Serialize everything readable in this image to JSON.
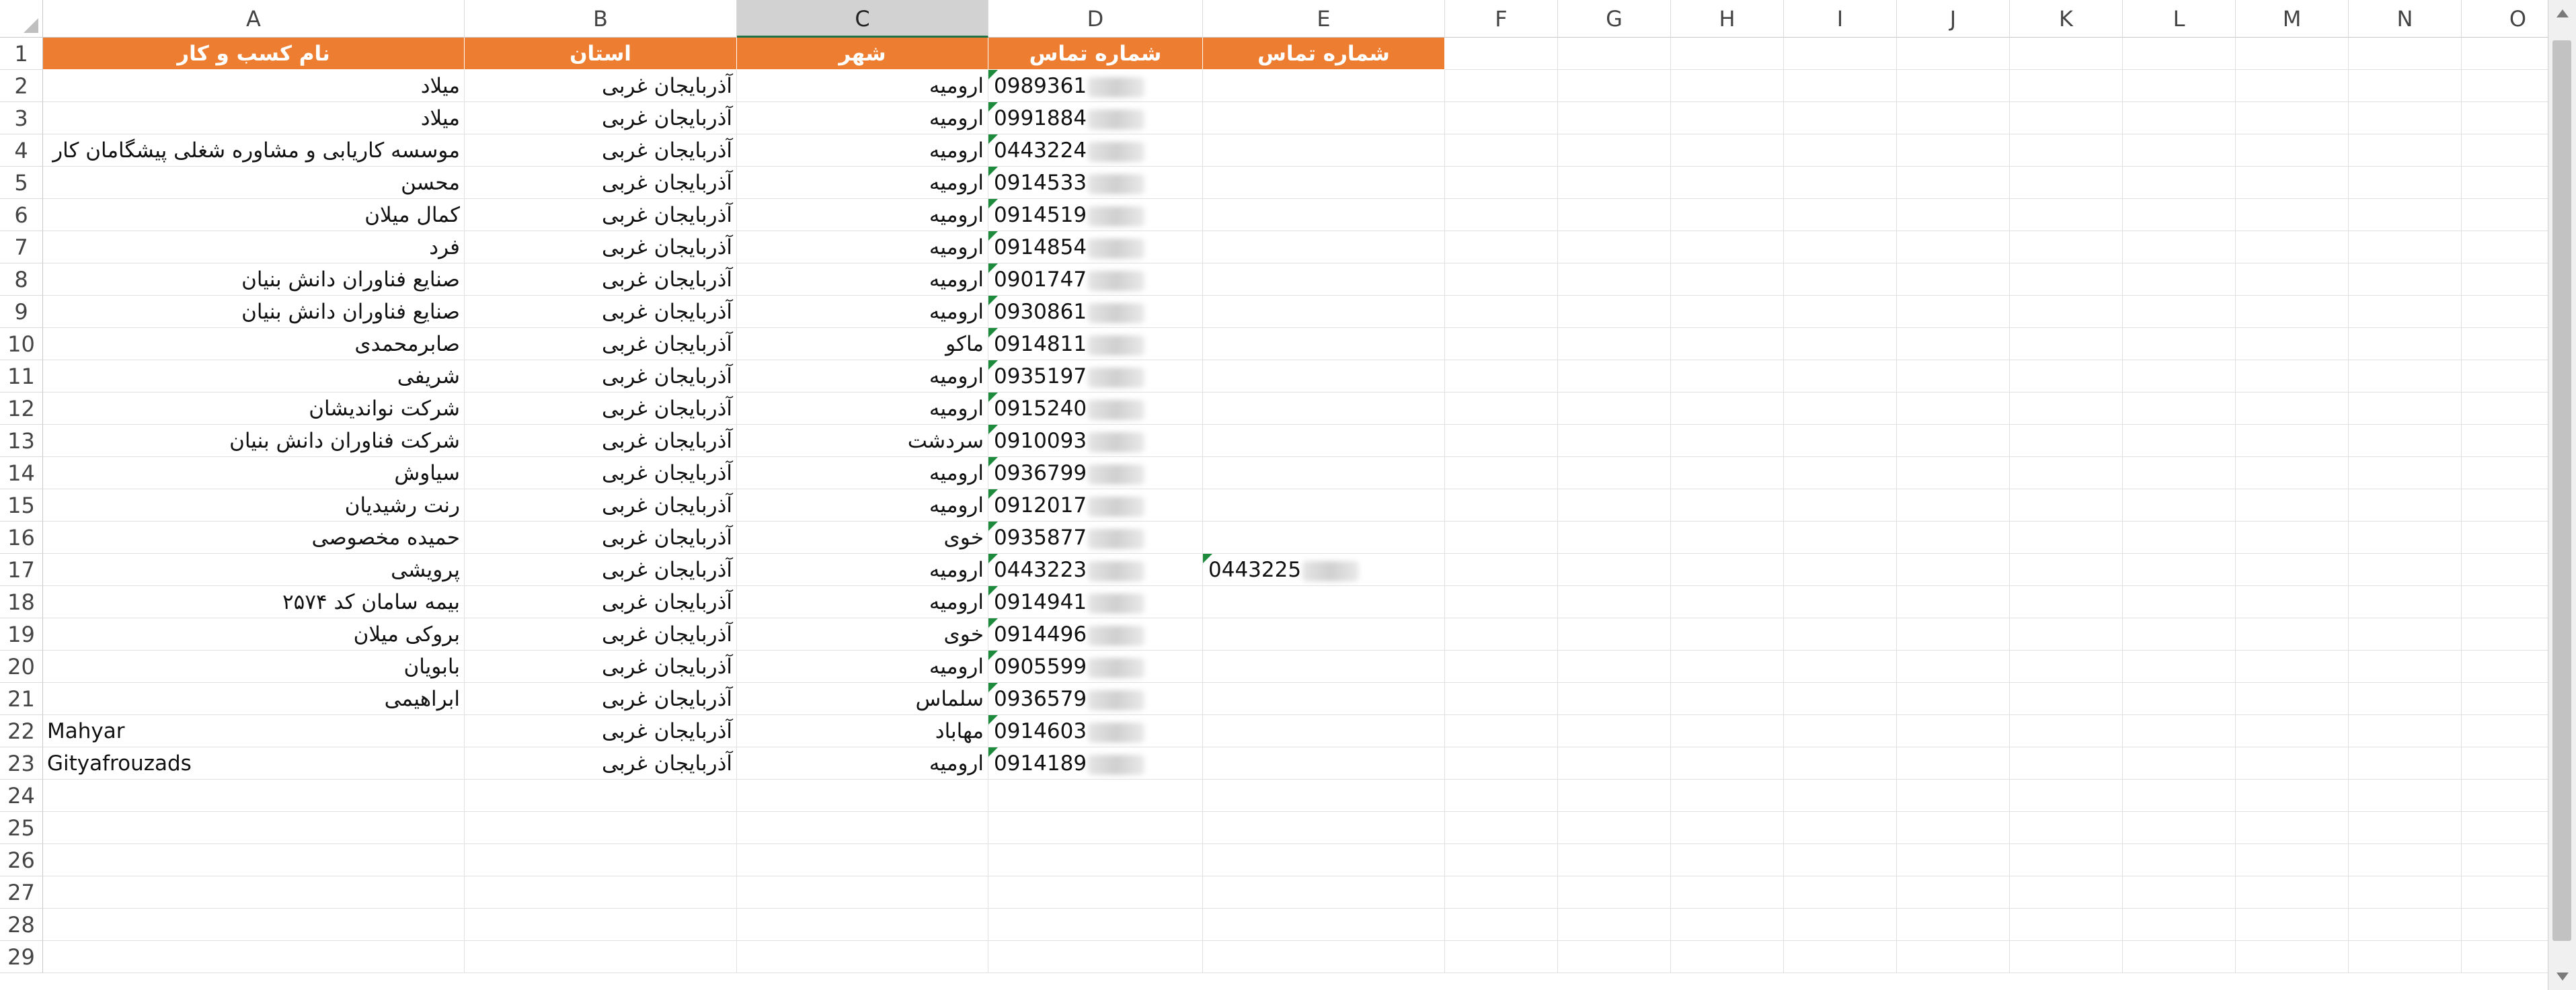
{
  "columns": [
    "A",
    "B",
    "C",
    "D",
    "E",
    "F",
    "G",
    "H",
    "I",
    "J",
    "K",
    "L",
    "M",
    "N",
    "O"
  ],
  "selected_column": "C",
  "header_row": {
    "A": "نام کسب و کار",
    "B": "استان",
    "C": "شهر",
    "D": "شماره تماس",
    "E": "شماره تماس"
  },
  "rows": [
    {
      "num": "2",
      "a": "میلاد",
      "b": "آذربایجان غربی",
      "c": "ارومیه",
      "d": "0989361"
    },
    {
      "num": "3",
      "a": "میلاد",
      "b": "آذربایجان غربی",
      "c": "ارومیه",
      "d": "0991884"
    },
    {
      "num": "4",
      "a": "موسسه کاریابی و مشاوره شغلی پیشگامان کار",
      "b": "آذربایجان غربی",
      "c": "ارومیه",
      "d": "0443224"
    },
    {
      "num": "5",
      "a": "محسن",
      "b": "آذربایجان غربی",
      "c": "ارومیه",
      "d": "0914533"
    },
    {
      "num": "6",
      "a": "کمال میلان",
      "b": "آذربایجان غربی",
      "c": "ارومیه",
      "d": "0914519"
    },
    {
      "num": "7",
      "a": "فرد",
      "b": "آذربایجان غربی",
      "c": "ارومیه",
      "d": "0914854"
    },
    {
      "num": "8",
      "a": "صنایع فناوران دانش بنیان",
      "b": "آذربایجان غربی",
      "c": "ارومیه",
      "d": "0901747"
    },
    {
      "num": "9",
      "a": "صنایع فناوران دانش بنیان",
      "b": "آذربایجان غربی",
      "c": "ارومیه",
      "d": "0930861"
    },
    {
      "num": "10",
      "a": "صابرمحمدی",
      "b": "آذربایجان غربی",
      "c": "ماکو",
      "d": "0914811"
    },
    {
      "num": "11",
      "a": "شریفی",
      "b": "آذربایجان غربی",
      "c": "ارومیه",
      "d": "0935197"
    },
    {
      "num": "12",
      "a": "شرکت نواندیشان",
      "b": "آذربایجان غربی",
      "c": "ارومیه",
      "d": "0915240"
    },
    {
      "num": "13",
      "a": "شرکت فناوران دانش بنیان",
      "b": "آذربایجان غربی",
      "c": "سردشت",
      "d": "0910093"
    },
    {
      "num": "14",
      "a": "سیاوش",
      "b": "آذربایجان غربی",
      "c": "ارومیه",
      "d": "0936799"
    },
    {
      "num": "15",
      "a": "رنت رشیدیان",
      "b": "آذربایجان غربی",
      "c": "ارومیه",
      "d": "0912017"
    },
    {
      "num": "16",
      "a": "حمیده مخصوصی",
      "b": "آذربایجان غربی",
      "c": "خوی",
      "d": "0935877"
    },
    {
      "num": "17",
      "a": "پرویشی",
      "b": "آذربایجان غربی",
      "c": "ارومیه",
      "d": "0443223",
      "e": "0443225"
    },
    {
      "num": "18",
      "a": "بیمه سامان کد ۲۵۷۴",
      "b": "آذربایجان غربی",
      "c": "ارومیه",
      "d": "0914941"
    },
    {
      "num": "19",
      "a": "بروکی میلان",
      "b": "آذربایجان غربی",
      "c": "خوی",
      "d": "0914496"
    },
    {
      "num": "20",
      "a": "بابویان",
      "b": "آذربایجان غربی",
      "c": "ارومیه",
      "d": "0905599"
    },
    {
      "num": "21",
      "a": "ابراهیمی",
      "b": "آذربایجان غربی",
      "c": "سلماس",
      "d": "0936579"
    },
    {
      "num": "22",
      "a": "Mahyar",
      "b": "آذربایجان غربی",
      "c": "مهاباد",
      "d": "0914603"
    },
    {
      "num": "23",
      "a": "Gityafrouzads",
      "b": "آذربایجان غربی",
      "c": "ارومیه",
      "d": "0914189"
    }
  ],
  "empty_rows": [
    "24",
    "25",
    "26",
    "27",
    "28",
    "29"
  ],
  "colors": {
    "header_fill": "#ed7d31",
    "header_text": "#ffffff",
    "selection": "#217346",
    "number_flag": "#1e8b3c"
  }
}
